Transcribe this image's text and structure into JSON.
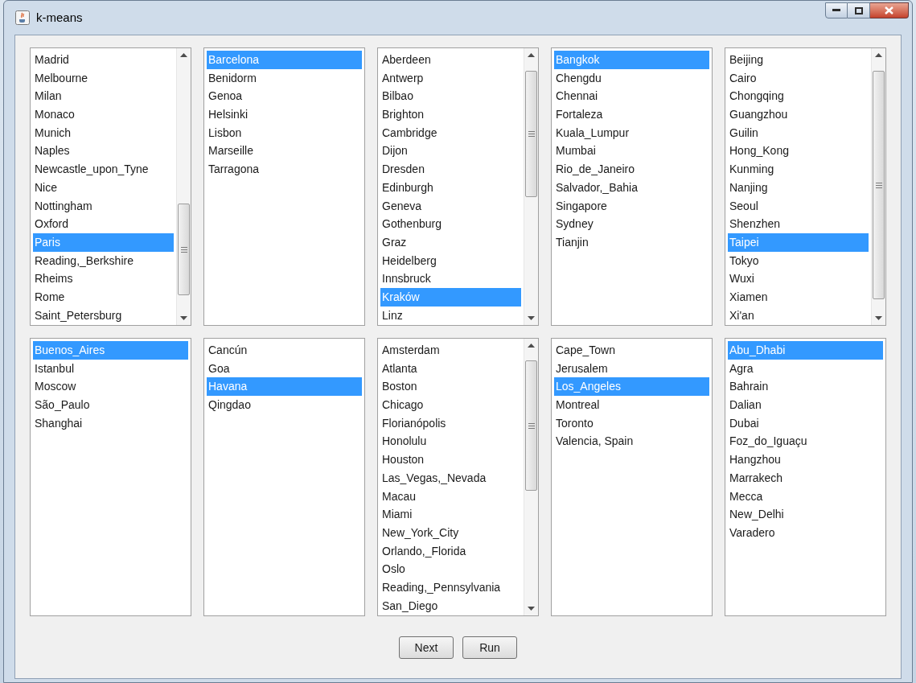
{
  "window": {
    "title": "k-means"
  },
  "lists": [
    {
      "scrollable": true,
      "items": [
        {
          "label": "Madrid",
          "selected": false
        },
        {
          "label": "Melbourne",
          "selected": false
        },
        {
          "label": "Milan",
          "selected": false
        },
        {
          "label": "Monaco",
          "selected": false
        },
        {
          "label": "Munich",
          "selected": false
        },
        {
          "label": "Naples",
          "selected": false
        },
        {
          "label": "Newcastle_upon_Tyne",
          "selected": false
        },
        {
          "label": "Nice",
          "selected": false
        },
        {
          "label": "Nottingham",
          "selected": false
        },
        {
          "label": "Oxford",
          "selected": false
        },
        {
          "label": "Paris",
          "selected": true
        },
        {
          "label": "Reading,_Berkshire",
          "selected": false
        },
        {
          "label": "Rheims",
          "selected": false
        },
        {
          "label": "Rome",
          "selected": false
        },
        {
          "label": "Saint_Petersburg",
          "selected": false
        }
      ]
    },
    {
      "scrollable": false,
      "items": [
        {
          "label": "Barcelona",
          "selected": true
        },
        {
          "label": "Benidorm",
          "selected": false
        },
        {
          "label": "Genoa",
          "selected": false
        },
        {
          "label": "Helsinki",
          "selected": false
        },
        {
          "label": "Lisbon",
          "selected": false
        },
        {
          "label": "Marseille",
          "selected": false
        },
        {
          "label": "Tarragona",
          "selected": false
        }
      ]
    },
    {
      "scrollable": true,
      "items": [
        {
          "label": "Aberdeen",
          "selected": false
        },
        {
          "label": "Antwerp",
          "selected": false
        },
        {
          "label": "Bilbao",
          "selected": false
        },
        {
          "label": "Brighton",
          "selected": false
        },
        {
          "label": "Cambridge",
          "selected": false
        },
        {
          "label": "Dijon",
          "selected": false
        },
        {
          "label": "Dresden",
          "selected": false
        },
        {
          "label": "Edinburgh",
          "selected": false
        },
        {
          "label": "Geneva",
          "selected": false
        },
        {
          "label": "Gothenburg",
          "selected": false
        },
        {
          "label": "Graz",
          "selected": false
        },
        {
          "label": "Heidelberg",
          "selected": false
        },
        {
          "label": "Innsbruck",
          "selected": false
        },
        {
          "label": "Kraków",
          "selected": true
        },
        {
          "label": "Linz",
          "selected": false
        }
      ]
    },
    {
      "scrollable": false,
      "items": [
        {
          "label": "Bangkok",
          "selected": true
        },
        {
          "label": "Chengdu",
          "selected": false
        },
        {
          "label": "Chennai",
          "selected": false
        },
        {
          "label": "Fortaleza",
          "selected": false
        },
        {
          "label": "Kuala_Lumpur",
          "selected": false
        },
        {
          "label": "Mumbai",
          "selected": false
        },
        {
          "label": "Rio_de_Janeiro",
          "selected": false
        },
        {
          "label": "Salvador,_Bahia",
          "selected": false
        },
        {
          "label": "Singapore",
          "selected": false
        },
        {
          "label": "Sydney",
          "selected": false
        },
        {
          "label": "Tianjin",
          "selected": false
        }
      ]
    },
    {
      "scrollable": true,
      "items": [
        {
          "label": "Beijing",
          "selected": false
        },
        {
          "label": "Cairo",
          "selected": false
        },
        {
          "label": "Chongqing",
          "selected": false
        },
        {
          "label": "Guangzhou",
          "selected": false
        },
        {
          "label": "Guilin",
          "selected": false
        },
        {
          "label": "Hong_Kong",
          "selected": false
        },
        {
          "label": "Kunming",
          "selected": false
        },
        {
          "label": "Nanjing",
          "selected": false
        },
        {
          "label": "Seoul",
          "selected": false
        },
        {
          "label": "Shenzhen",
          "selected": false
        },
        {
          "label": "Taipei",
          "selected": true
        },
        {
          "label": "Tokyo",
          "selected": false
        },
        {
          "label": "Wuxi",
          "selected": false
        },
        {
          "label": "Xiamen",
          "selected": false
        },
        {
          "label": "Xi'an",
          "selected": false
        }
      ]
    },
    {
      "scrollable": false,
      "items": [
        {
          "label": "Buenos_Aires",
          "selected": true
        },
        {
          "label": "Istanbul",
          "selected": false
        },
        {
          "label": "Moscow",
          "selected": false
        },
        {
          "label": "São_Paulo",
          "selected": false
        },
        {
          "label": "Shanghai",
          "selected": false
        }
      ]
    },
    {
      "scrollable": false,
      "items": [
        {
          "label": "Cancún",
          "selected": false
        },
        {
          "label": "Goa",
          "selected": false
        },
        {
          "label": "Havana",
          "selected": true
        },
        {
          "label": "Qingdao",
          "selected": false
        }
      ]
    },
    {
      "scrollable": true,
      "items": [
        {
          "label": "Amsterdam",
          "selected": false
        },
        {
          "label": "Atlanta",
          "selected": false
        },
        {
          "label": "Boston",
          "selected": false
        },
        {
          "label": "Chicago",
          "selected": false
        },
        {
          "label": "Florianópolis",
          "selected": false
        },
        {
          "label": "Honolulu",
          "selected": false
        },
        {
          "label": "Houston",
          "selected": false
        },
        {
          "label": "Las_Vegas,_Nevada",
          "selected": false
        },
        {
          "label": "Macau",
          "selected": false
        },
        {
          "label": "Miami",
          "selected": false
        },
        {
          "label": "New_York_City",
          "selected": false
        },
        {
          "label": "Orlando,_Florida",
          "selected": false
        },
        {
          "label": "Oslo",
          "selected": false
        },
        {
          "label": "Reading,_Pennsylvania",
          "selected": false
        },
        {
          "label": "San_Diego",
          "selected": false
        }
      ]
    },
    {
      "scrollable": false,
      "items": [
        {
          "label": "Cape_Town",
          "selected": false
        },
        {
          "label": "Jerusalem",
          "selected": false
        },
        {
          "label": "Los_Angeles",
          "selected": true
        },
        {
          "label": "Montreal",
          "selected": false
        },
        {
          "label": "Toronto",
          "selected": false
        },
        {
          "label": "Valencia, Spain",
          "selected": false
        }
      ]
    },
    {
      "scrollable": false,
      "items": [
        {
          "label": "Abu_Dhabi",
          "selected": true
        },
        {
          "label": "Agra",
          "selected": false
        },
        {
          "label": "Bahrain",
          "selected": false
        },
        {
          "label": "Dalian",
          "selected": false
        },
        {
          "label": "Dubai",
          "selected": false
        },
        {
          "label": "Foz_do_Iguaçu",
          "selected": false
        },
        {
          "label": "Hangzhou",
          "selected": false
        },
        {
          "label": "Marrakech",
          "selected": false
        },
        {
          "label": "Mecca",
          "selected": false
        },
        {
          "label": "New_Delhi",
          "selected": false
        },
        {
          "label": "Varadero",
          "selected": false
        }
      ]
    }
  ],
  "buttons": [
    {
      "label": "Next"
    },
    {
      "label": "Run"
    }
  ]
}
